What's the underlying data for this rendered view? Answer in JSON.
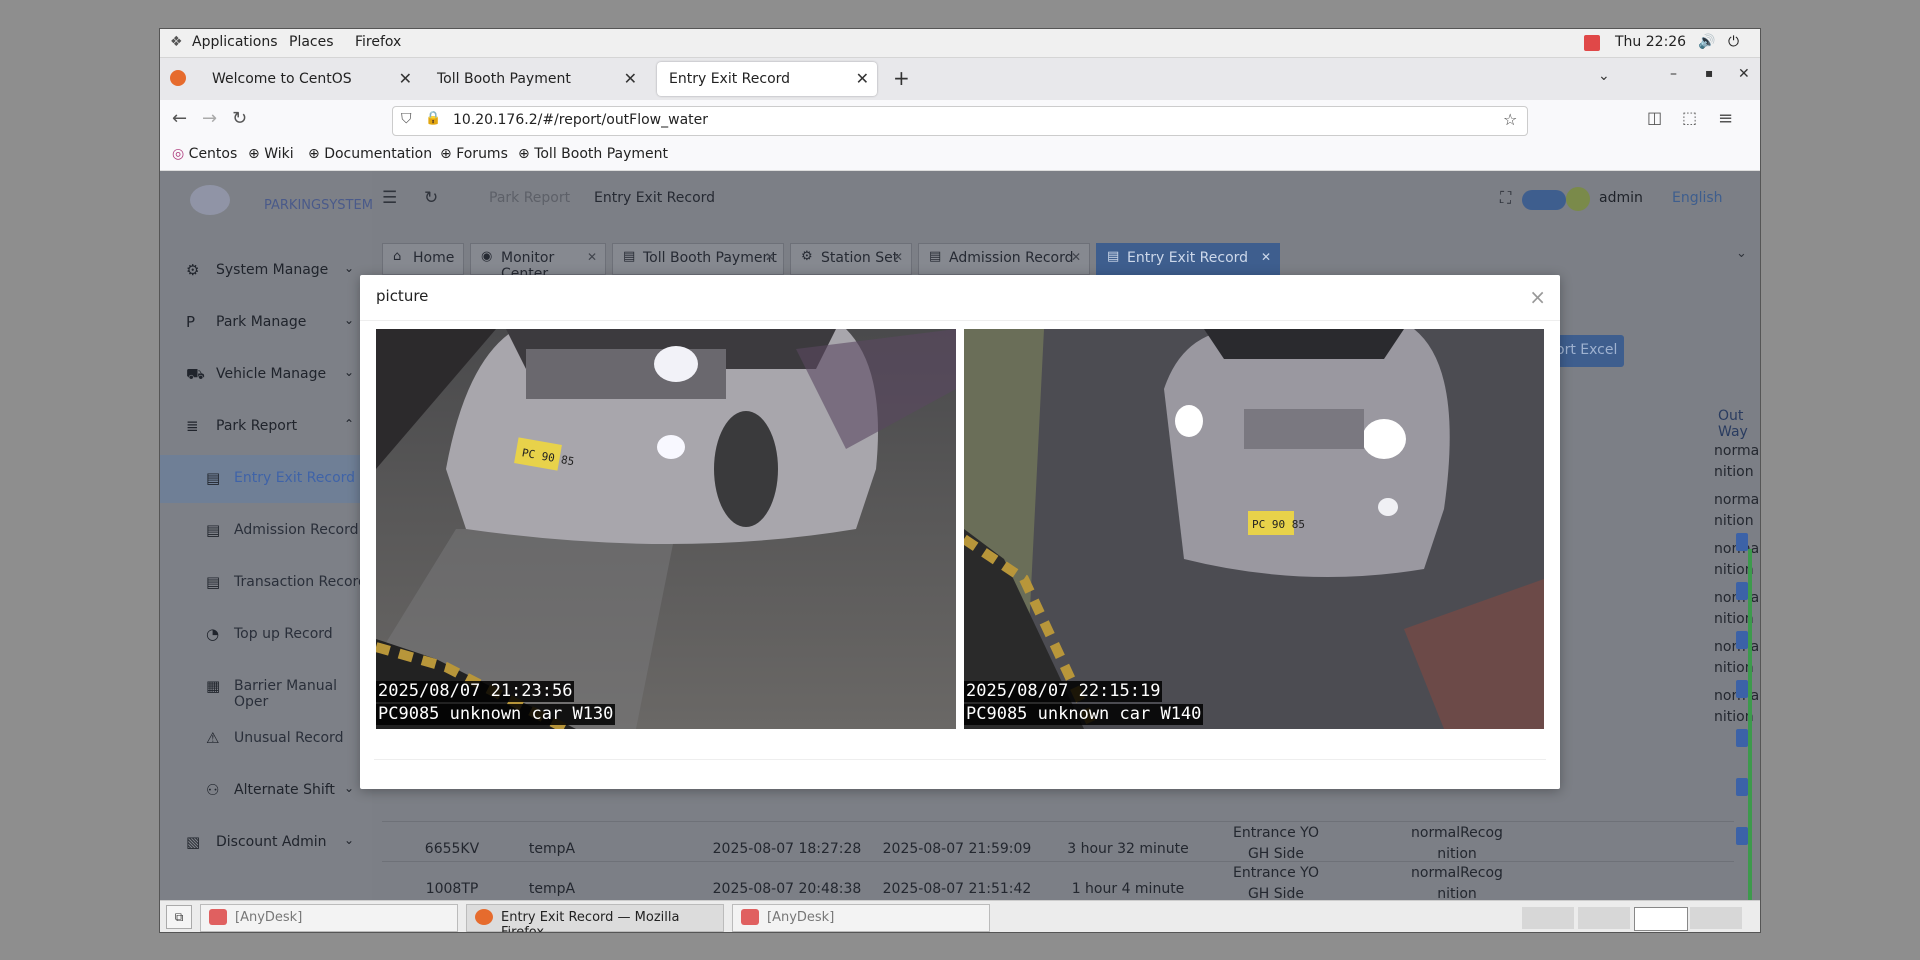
{
  "topbar": {
    "applications": "Applications",
    "places": "Places",
    "firefox": "Firefox",
    "clock": "Thu 22:26"
  },
  "browser_tabs": [
    {
      "label": "Welcome to CentOS"
    },
    {
      "label": "Toll Booth Payment"
    },
    {
      "label": "Entry Exit Record"
    }
  ],
  "address": "10.20.176.2/#/report/outFlow_water",
  "bookmarks": [
    "Centos",
    "Wiki",
    "Documentation",
    "Forums",
    "Toll Booth Payment"
  ],
  "header": {
    "logo_text": "PARKINGSYSTEM",
    "crumb_1": "Park Report",
    "crumb_2": "Entry Exit Record",
    "user": "admin",
    "language": "English"
  },
  "sidebar": {
    "items": [
      {
        "label": "System Manage"
      },
      {
        "label": "Park Manage"
      },
      {
        "label": "Vehicle Manage"
      },
      {
        "label": "Park Report"
      },
      {
        "label": "Entry Exit Record"
      },
      {
        "label": "Admission Record"
      },
      {
        "label": "Transaction Record"
      },
      {
        "label": "Top up Record"
      },
      {
        "label": "Barrier Manual Oper"
      },
      {
        "label": "Unusual Record"
      },
      {
        "label": "Alternate Shift"
      },
      {
        "label": "Discount Admin"
      }
    ]
  },
  "page_tabs": [
    "Home",
    "Monitor Center",
    "Toll Booth Payment",
    "Station Set",
    "Admission Record",
    "Entry Exit Record"
  ],
  "export_button": "Export Excel",
  "table": {
    "out_way_header": "Out Way",
    "partial_cells": [
      "normalRecog",
      "nition"
    ],
    "rows": [
      {
        "plate": "6655KV",
        "type": "tempA",
        "in_time": "2025-08-07 18:27:28",
        "out_time": "2025-08-07 21:59:09",
        "duration": "3 hour 32 minute",
        "entrance_1": "Entrance YO",
        "entrance_2": "GH Side",
        "recog_1": "normalRecog",
        "recog_2": "nition"
      },
      {
        "plate": "1008TP",
        "type": "tempA",
        "in_time": "2025-08-07 20:48:38",
        "out_time": "2025-08-07 21:51:42",
        "duration": "1 hour 4 minute",
        "entrance_1": "Entrance YO",
        "entrance_2": "GH Side",
        "recog_1": "normalRecog",
        "recog_2": "nition"
      }
    ]
  },
  "modal": {
    "title": "picture",
    "photos": [
      {
        "line1": "2025/08/07 21:23:56",
        "line2": "PC9085 unknown car W130",
        "plate": "PC 90 85"
      },
      {
        "line1": "2025/08/07 22:15:19",
        "line2": "PC9085 unknown car W140",
        "plate": "PC 90 85"
      }
    ]
  },
  "taskbar": {
    "items": [
      {
        "label": "[AnyDesk]"
      },
      {
        "label": "Entry Exit Record — Mozilla Firefox"
      },
      {
        "label": "[AnyDesk]"
      }
    ]
  }
}
